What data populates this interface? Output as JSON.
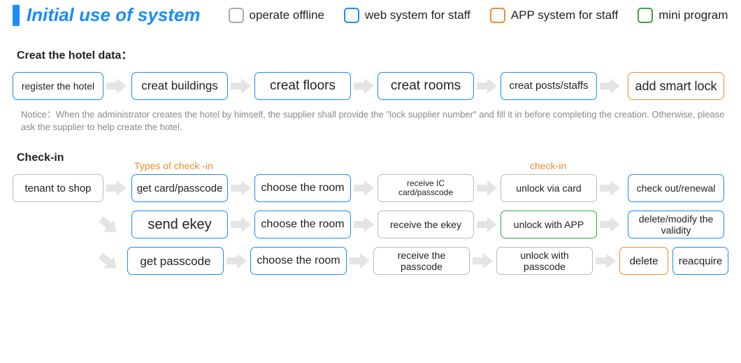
{
  "title": "Initial use of system",
  "legend": {
    "offline": "operate offline",
    "web": "web system for staff",
    "app": "APP system for staff",
    "mini": "mini program"
  },
  "section1_heading": "Creat the hotel data：",
  "flow1": {
    "register": "register the hotel",
    "buildings": "creat buildings",
    "floors": "creat floors",
    "rooms": "creat rooms",
    "posts": "creat posts/staffs",
    "lock": "add smart lock"
  },
  "notice": "Notice：When the administrator creates the hotel by himself, the supplier shall provide the \"lock supplier number\" and fill it in before completing the creation. Otherwise, please ask the supplier to help create the hotel.",
  "section2_heading": "Check-in",
  "annot_types": "Types of check -in",
  "annot_checkin": "check-in",
  "checkin": {
    "tenant": "tenant to shop",
    "r1": {
      "a": "get card/passcode",
      "b": "choose the room",
      "c": "receive IC card/passcode",
      "d": "unlock via card",
      "e": "check out/renewal"
    },
    "r2": {
      "a": "send ekey",
      "b": "choose the room",
      "c": "receive the ekey",
      "d": "unlock with APP",
      "e": "delete/modify the validity"
    },
    "r3": {
      "a": "get passcode",
      "b": "choose the room",
      "c": "receive the passcode",
      "d": "unlock with passcode",
      "e1": "delete",
      "e2": "reacquire"
    }
  }
}
